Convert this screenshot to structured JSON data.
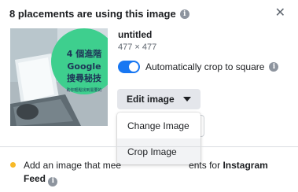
{
  "header": {
    "title": "8 placements are using this image",
    "info_icon": "info-icon",
    "close_icon": "close-icon",
    "close_glyph": "✕"
  },
  "image": {
    "title": "untitled",
    "dimensions": "477 × 477",
    "thumbnail_text": {
      "line1": "4 個進階",
      "line2": "Google",
      "line3": "搜尋秘技",
      "line4": "助你輕鬆找到需要的"
    }
  },
  "crop_toggle": {
    "label": "Automatically crop to square",
    "state": "on",
    "accent": "#1877f2"
  },
  "edit_menu": {
    "button_label": "Edit image",
    "items": [
      {
        "label": "Change Image"
      },
      {
        "label": "Crop Image"
      }
    ]
  },
  "notice": {
    "visible_start": "Add an image that mee",
    "visible_end": "ents for",
    "bold_part": "Instagram Feed",
    "dot_color": "#f7b928"
  }
}
